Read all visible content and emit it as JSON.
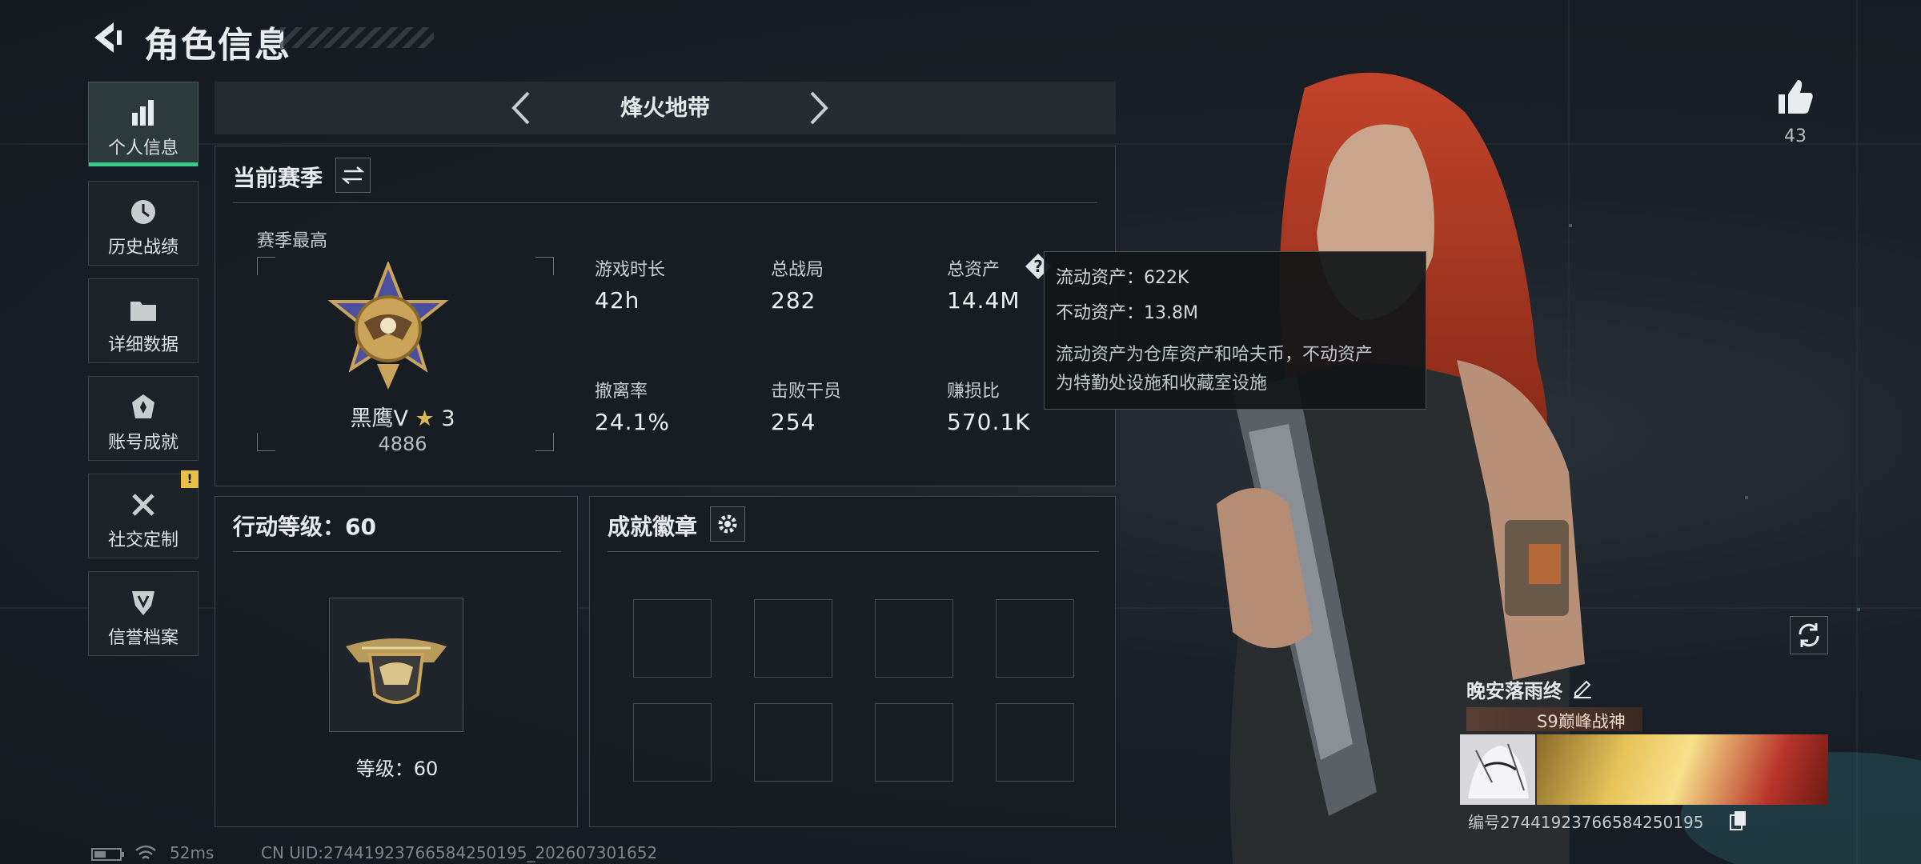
{
  "header": {
    "title": "角色信息"
  },
  "nav": [
    {
      "label": "个人信息",
      "icon": "bar-chart-icon",
      "active": true
    },
    {
      "label": "历史战绩",
      "icon": "history-clock-icon"
    },
    {
      "label": "详细数据",
      "icon": "folder-icon"
    },
    {
      "label": "账号成就",
      "icon": "achievement-icon"
    },
    {
      "label": "社交定制",
      "icon": "tools-icon",
      "badge": "!"
    },
    {
      "label": "信誉档案",
      "icon": "shield-emblem-icon"
    }
  ],
  "mode": {
    "title": "烽火地带"
  },
  "season": {
    "title": "当前赛季",
    "best_label": "赛季最高",
    "rank_name": "黑鹰V",
    "rank_stars": "3",
    "rank_score": "4886",
    "stats": [
      {
        "label": "游戏时长",
        "value": "42h"
      },
      {
        "label": "总战局",
        "value": "282"
      },
      {
        "label": "总资产",
        "value": "14.4M"
      },
      {
        "label": "撤离率",
        "value": "24.1%"
      },
      {
        "label": "击败干员",
        "value": "254"
      },
      {
        "label": "赚损比",
        "value": "570.1K"
      }
    ]
  },
  "tooltip": {
    "line1": "流动资产：622K",
    "line2": "不动资产：13.8M",
    "desc1": "流动资产为仓库资产和哈夫币，不动资产",
    "desc2": "为特勤处设施和收藏室设施"
  },
  "action_level": {
    "title": "行动等级：60",
    "level_label": "等级：60"
  },
  "achievements": {
    "title": "成就徽章"
  },
  "profile": {
    "likes": "43",
    "name": "晚安落雨终",
    "tag": "S9巅峰战神",
    "id_text": "编号2744192376658425019​5"
  },
  "status": {
    "ping": "52ms",
    "uid": "CN UID:27441923766584250195_202607301652"
  },
  "colors": {
    "accent": "#38c98c",
    "badge": "#e6c04a",
    "hair": "#b33a24"
  }
}
